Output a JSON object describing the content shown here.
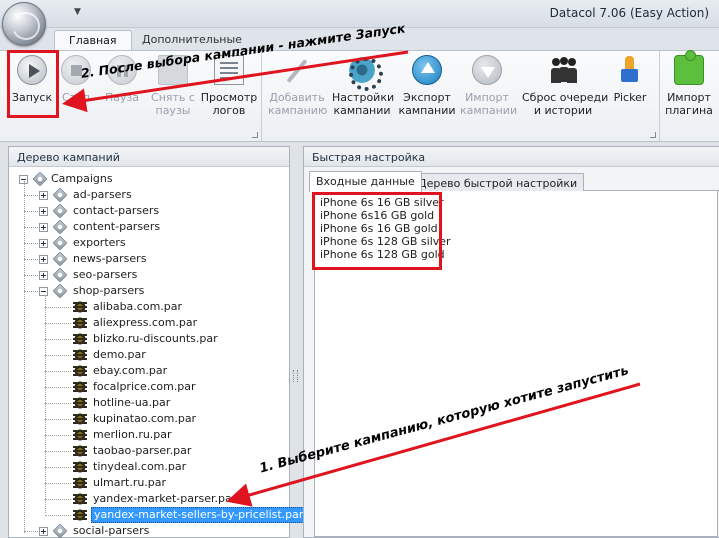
{
  "window": {
    "title": "Datacol 7.06 (Easy Action)",
    "qat_arrow": "▼"
  },
  "ribbon_tabs": [
    {
      "label": "Главная",
      "active": true
    },
    {
      "label": "Дополнительные",
      "active": false
    }
  ],
  "ribbon": {
    "start": "Запуск",
    "stop": "Стоп",
    "pause": "Пауза",
    "remove_pause_1": "Снять с",
    "remove_pause_2": "паузы",
    "view_logs_1": "Просмотр",
    "view_logs_2": "логов",
    "add_campaign_1": "Добавить",
    "add_campaign_2": "кампанию",
    "campaign_settings_1": "Настройки",
    "campaign_settings_2": "кампании",
    "export_campaign_1": "Экспорт",
    "export_campaign_2": "кампании",
    "import_campaign_1": "Импорт",
    "import_campaign_2": "кампании",
    "reset_queue_1": "Сброс очереди",
    "reset_queue_2": "и истории",
    "picker": "Picker",
    "import_plugin_1": "Импорт",
    "import_plugin_2": "плагина"
  },
  "left_panel": {
    "title": "Дерево кампаний",
    "root": "Campaigns",
    "folders_before": [
      "ad-parsers",
      "contact-parsers",
      "content-parsers",
      "exporters",
      "news-parsers",
      "seo-parsers"
    ],
    "open_folder": "shop-parsers",
    "campaigns": [
      "alibaba.com.par",
      "aliexpress.com.par",
      "blizko.ru-discounts.par",
      "demo.par",
      "ebay.com.par",
      "focalprice.com.par",
      "hotline-ua.par",
      "kupinatao.com.par",
      "merlion.ru.par",
      "taobao-parser.par",
      "tinydeal.com.par",
      "ulmart.ru.par",
      "yandex-market-parser.par"
    ],
    "selected_campaign": "yandex-market-sellers-by-pricelist.par",
    "folders_after": [
      "social-parsers"
    ]
  },
  "right_panel": {
    "title": "Быстрая настройка",
    "tabs": [
      "Входные данные",
      "Дерево быстрой настройки"
    ],
    "input_lines": [
      "iPhone 6s 16 GB silver",
      "iPhone 6s16 GB gold",
      "iPhone 6s 16 GB gold",
      "iPhone 6s 128 GB silver",
      "iPhone 6s 128 GB gold"
    ]
  },
  "annotations": {
    "step2": "2. После выбора кампании - нажмите Запуск",
    "step1": "1. Выберите кампанию, которую хотите запустить",
    "color": "#e0141e"
  }
}
